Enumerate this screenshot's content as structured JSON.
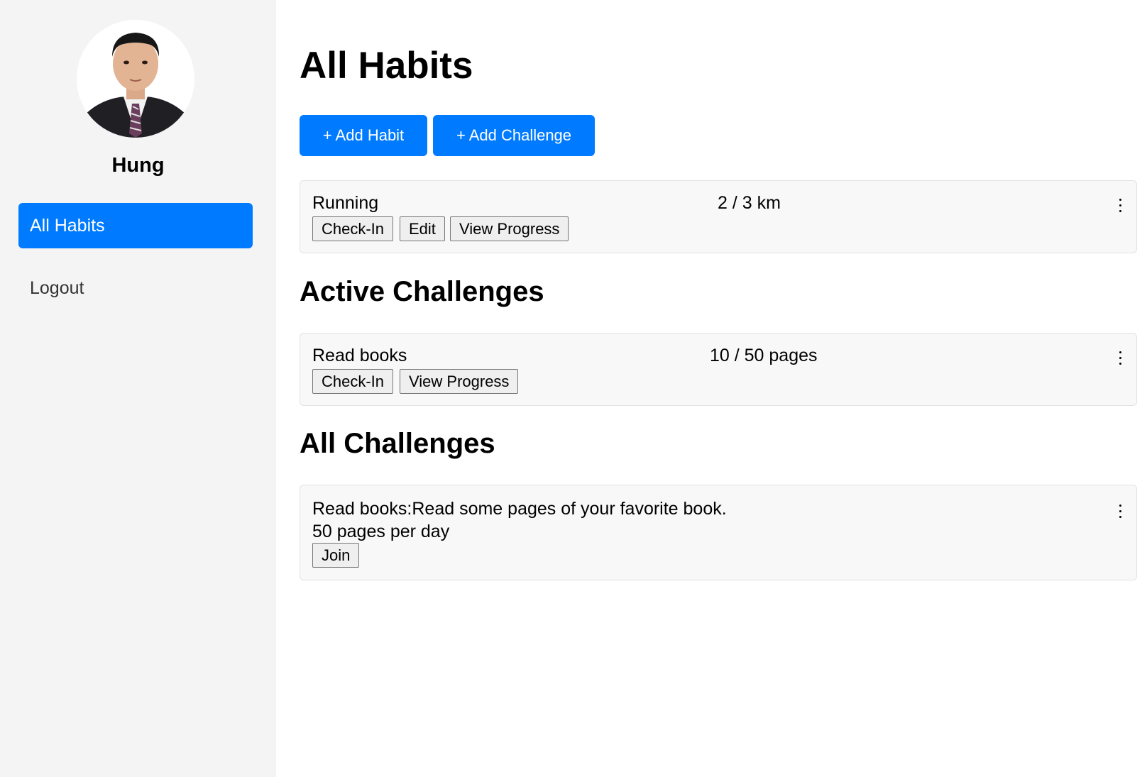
{
  "user": {
    "name": "Hung"
  },
  "sidebar": {
    "items": [
      {
        "label": "All Habits",
        "active": true
      },
      {
        "label": "Logout",
        "active": false
      }
    ]
  },
  "main": {
    "title": "All Habits",
    "buttons": {
      "add_habit": "+ Add Habit",
      "add_challenge": "+ Add Challenge"
    },
    "habits": [
      {
        "name": "Running",
        "progress": "2 / 3 km",
        "actions": [
          "Check-In",
          "Edit",
          "View Progress"
        ]
      }
    ],
    "active_challenges": {
      "title": "Active Challenges",
      "items": [
        {
          "name": "Read books",
          "progress": "10 / 50 pages",
          "actions": [
            "Check-In",
            "View Progress"
          ]
        }
      ]
    },
    "all_challenges": {
      "title": "All Challenges",
      "items": [
        {
          "line1": "Read books:Read some pages of your favorite book.",
          "line2": "50 pages per day",
          "action": "Join"
        }
      ]
    }
  },
  "colors": {
    "accent": "#007bff",
    "sidebar_bg": "#f4f4f4",
    "card_bg": "#f8f8f8"
  },
  "icons": {
    "more": "kebab-vertical",
    "avatar": "user-photo"
  }
}
